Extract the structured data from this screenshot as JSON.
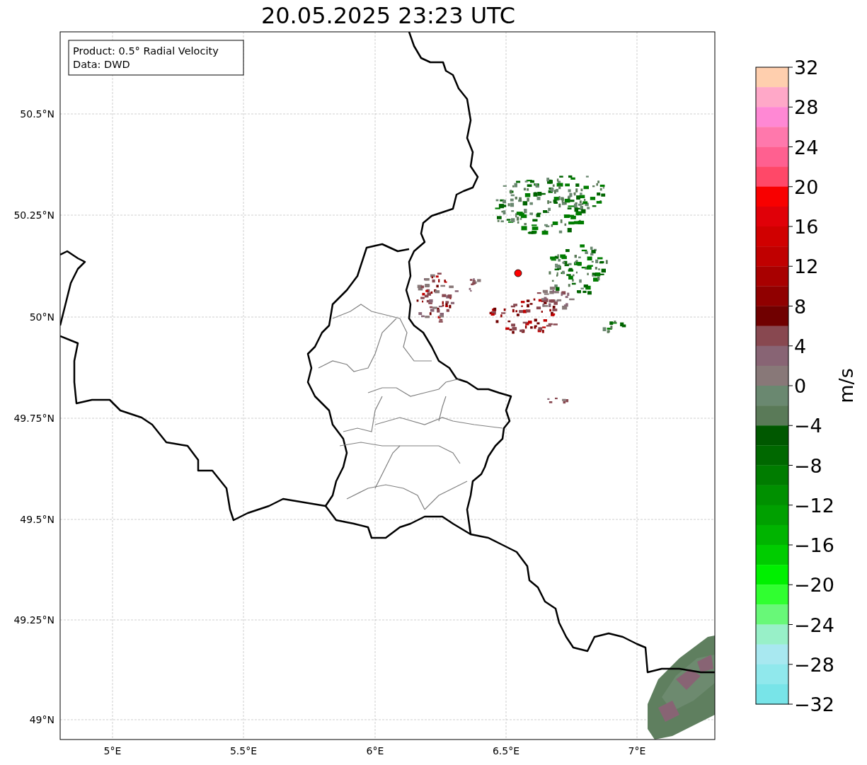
{
  "title": "20.05.2025 23:23 UTC",
  "info_box": {
    "lines": [
      "Product: 0.5° Radial Velocity",
      "Data: DWD"
    ]
  },
  "map": {
    "lat_labels": [
      "50.5°N",
      "50.25°N",
      "50°N",
      "49.75°N",
      "49.5°N",
      "49.25°N",
      "49°N"
    ],
    "lon_labels": [
      "5°E",
      "5.5°E",
      "6°E",
      "6.5°E",
      "7°E"
    ]
  },
  "colorbar": {
    "label": "m/s",
    "tick_labels": [
      "32",
      "28",
      "24",
      "20",
      "16",
      "12",
      "8",
      "4",
      "0",
      "−4",
      "−8",
      "−12",
      "−16",
      "−20",
      "−24",
      "−28",
      "−32"
    ],
    "segments": [
      {
        "color": "#ffcfae"
      },
      {
        "color": "#ffa8c8"
      },
      {
        "color": "#ff88d4"
      },
      {
        "color": "#ff78ac"
      },
      {
        "color": "#ff6090"
      },
      {
        "color": "#ff4868"
      },
      {
        "color": "#f80000"
      },
      {
        "color": "#e00008"
      },
      {
        "color": "#d00000"
      },
      {
        "color": "#c00000"
      },
      {
        "color": "#a80000"
      },
      {
        "color": "#900000"
      },
      {
        "color": "#700000"
      },
      {
        "color": "#884850"
      },
      {
        "color": "#886474"
      },
      {
        "color": "#887878"
      },
      {
        "color": "#6a8870"
      },
      {
        "color": "#5a7a58"
      },
      {
        "color": "#005800"
      },
      {
        "color": "#006800"
      },
      {
        "color": "#007c00"
      },
      {
        "color": "#009000"
      },
      {
        "color": "#00a000"
      },
      {
        "color": "#00b400"
      },
      {
        "color": "#00cc00"
      },
      {
        "color": "#00f000"
      },
      {
        "color": "#30ff30"
      },
      {
        "color": "#68f878"
      },
      {
        "color": "#98f0c8"
      },
      {
        "color": "#a8e8f0"
      },
      {
        "color": "#90e8ec"
      },
      {
        "color": "#78e4e8"
      }
    ]
  }
}
